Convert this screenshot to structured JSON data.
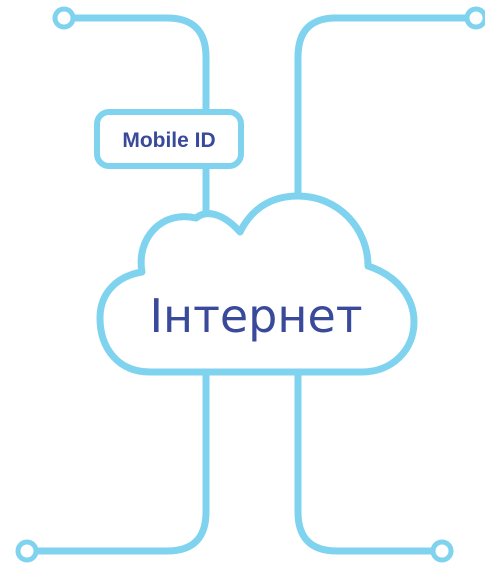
{
  "diagram": {
    "cloud_label": "Інтернет",
    "badge_label": "Mobile ID",
    "colors": {
      "line": "#7fd3ef",
      "text": "#3a4a9a",
      "background": "#ffffff"
    }
  }
}
